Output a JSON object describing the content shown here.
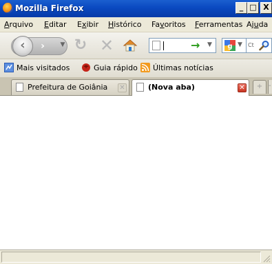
{
  "window": {
    "title": "Mozilla Firefox",
    "controls": {
      "minimize": "_",
      "maximize": "□",
      "close": "X"
    }
  },
  "menu": [
    {
      "label": "Arquivo",
      "accel": "A",
      "rest": "rquivo"
    },
    {
      "label": "Editar",
      "accel": "E",
      "rest": "ditar"
    },
    {
      "label": "Exibir",
      "pre": "E",
      "accel": "x",
      "rest": "ibir"
    },
    {
      "label": "Histórico",
      "accel": "H",
      "rest": "istórico"
    },
    {
      "label": "Favoritos",
      "pre": "Fa",
      "accel": "v",
      "rest": "oritos"
    },
    {
      "label": "Ferramentas",
      "accel": "F",
      "rest": "erramentas"
    },
    {
      "label": "Ajuda",
      "pre": "Aj",
      "accel": "u",
      "rest": "da"
    }
  ],
  "navigation": {
    "back_icon": "back-arrow-icon",
    "forward_icon": "forward-arrow-icon",
    "reload_icon": "reload-icon",
    "stop_icon": "stop-icon",
    "home_icon": "home-icon",
    "url": {
      "value": "",
      "go_icon": "go-arrow-icon"
    },
    "search": {
      "engine": "google-icon",
      "placeholder": "Ct"
    }
  },
  "bookmarks": [
    {
      "label": "Mais visitados",
      "icon": "most-visited-icon"
    },
    {
      "label": "Guia rápido",
      "icon": "firefox-guide-icon"
    },
    {
      "label": "Últimas notícias",
      "icon": "rss-feed-icon"
    }
  ],
  "tabs": [
    {
      "label": "Prefeitura de Goiânia",
      "active": false
    },
    {
      "label": "(Nova aba)",
      "active": true
    }
  ],
  "new_tab_label": "+",
  "tab_scroll_label": "-",
  "status": {
    "text": ""
  },
  "colors": {
    "titlebar": "#0a49c0",
    "chrome": "#ece9d8",
    "active_tab_close": "#c8331f",
    "go_arrow": "#2b9b1c"
  }
}
